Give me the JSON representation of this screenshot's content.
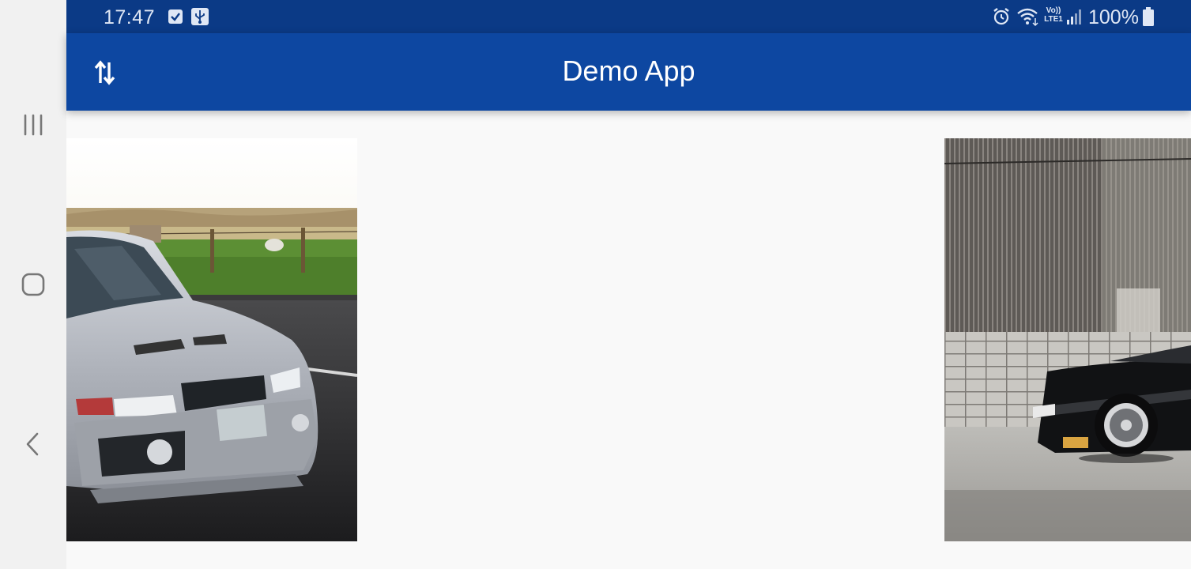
{
  "status_bar": {
    "time": "17:47",
    "icons": [
      "checkbox-notification-icon",
      "usb-icon",
      "alarm-icon",
      "wifi-icon",
      "volte-lte-icon",
      "signal-icon",
      "battery-icon"
    ],
    "volte_label": "Vo))",
    "lte_label": "LTE1",
    "battery": "100%"
  },
  "app_bar": {
    "title": "Demo App",
    "sort_icon": "swap-vertical-icon"
  },
  "system_nav": {
    "icons": [
      "recent-apps-icon",
      "home-icon",
      "back-icon"
    ]
  },
  "gallery": {
    "items": [
      {
        "subject": "silver-sedan-car-photo"
      },
      {
        "subject": "black-sports-car-photo"
      }
    ]
  },
  "colors": {
    "status_bar": "#0b3a86",
    "app_bar": "#0d47a1",
    "background": "#f9f9f9",
    "nav_bar": "#f1f1f1"
  }
}
